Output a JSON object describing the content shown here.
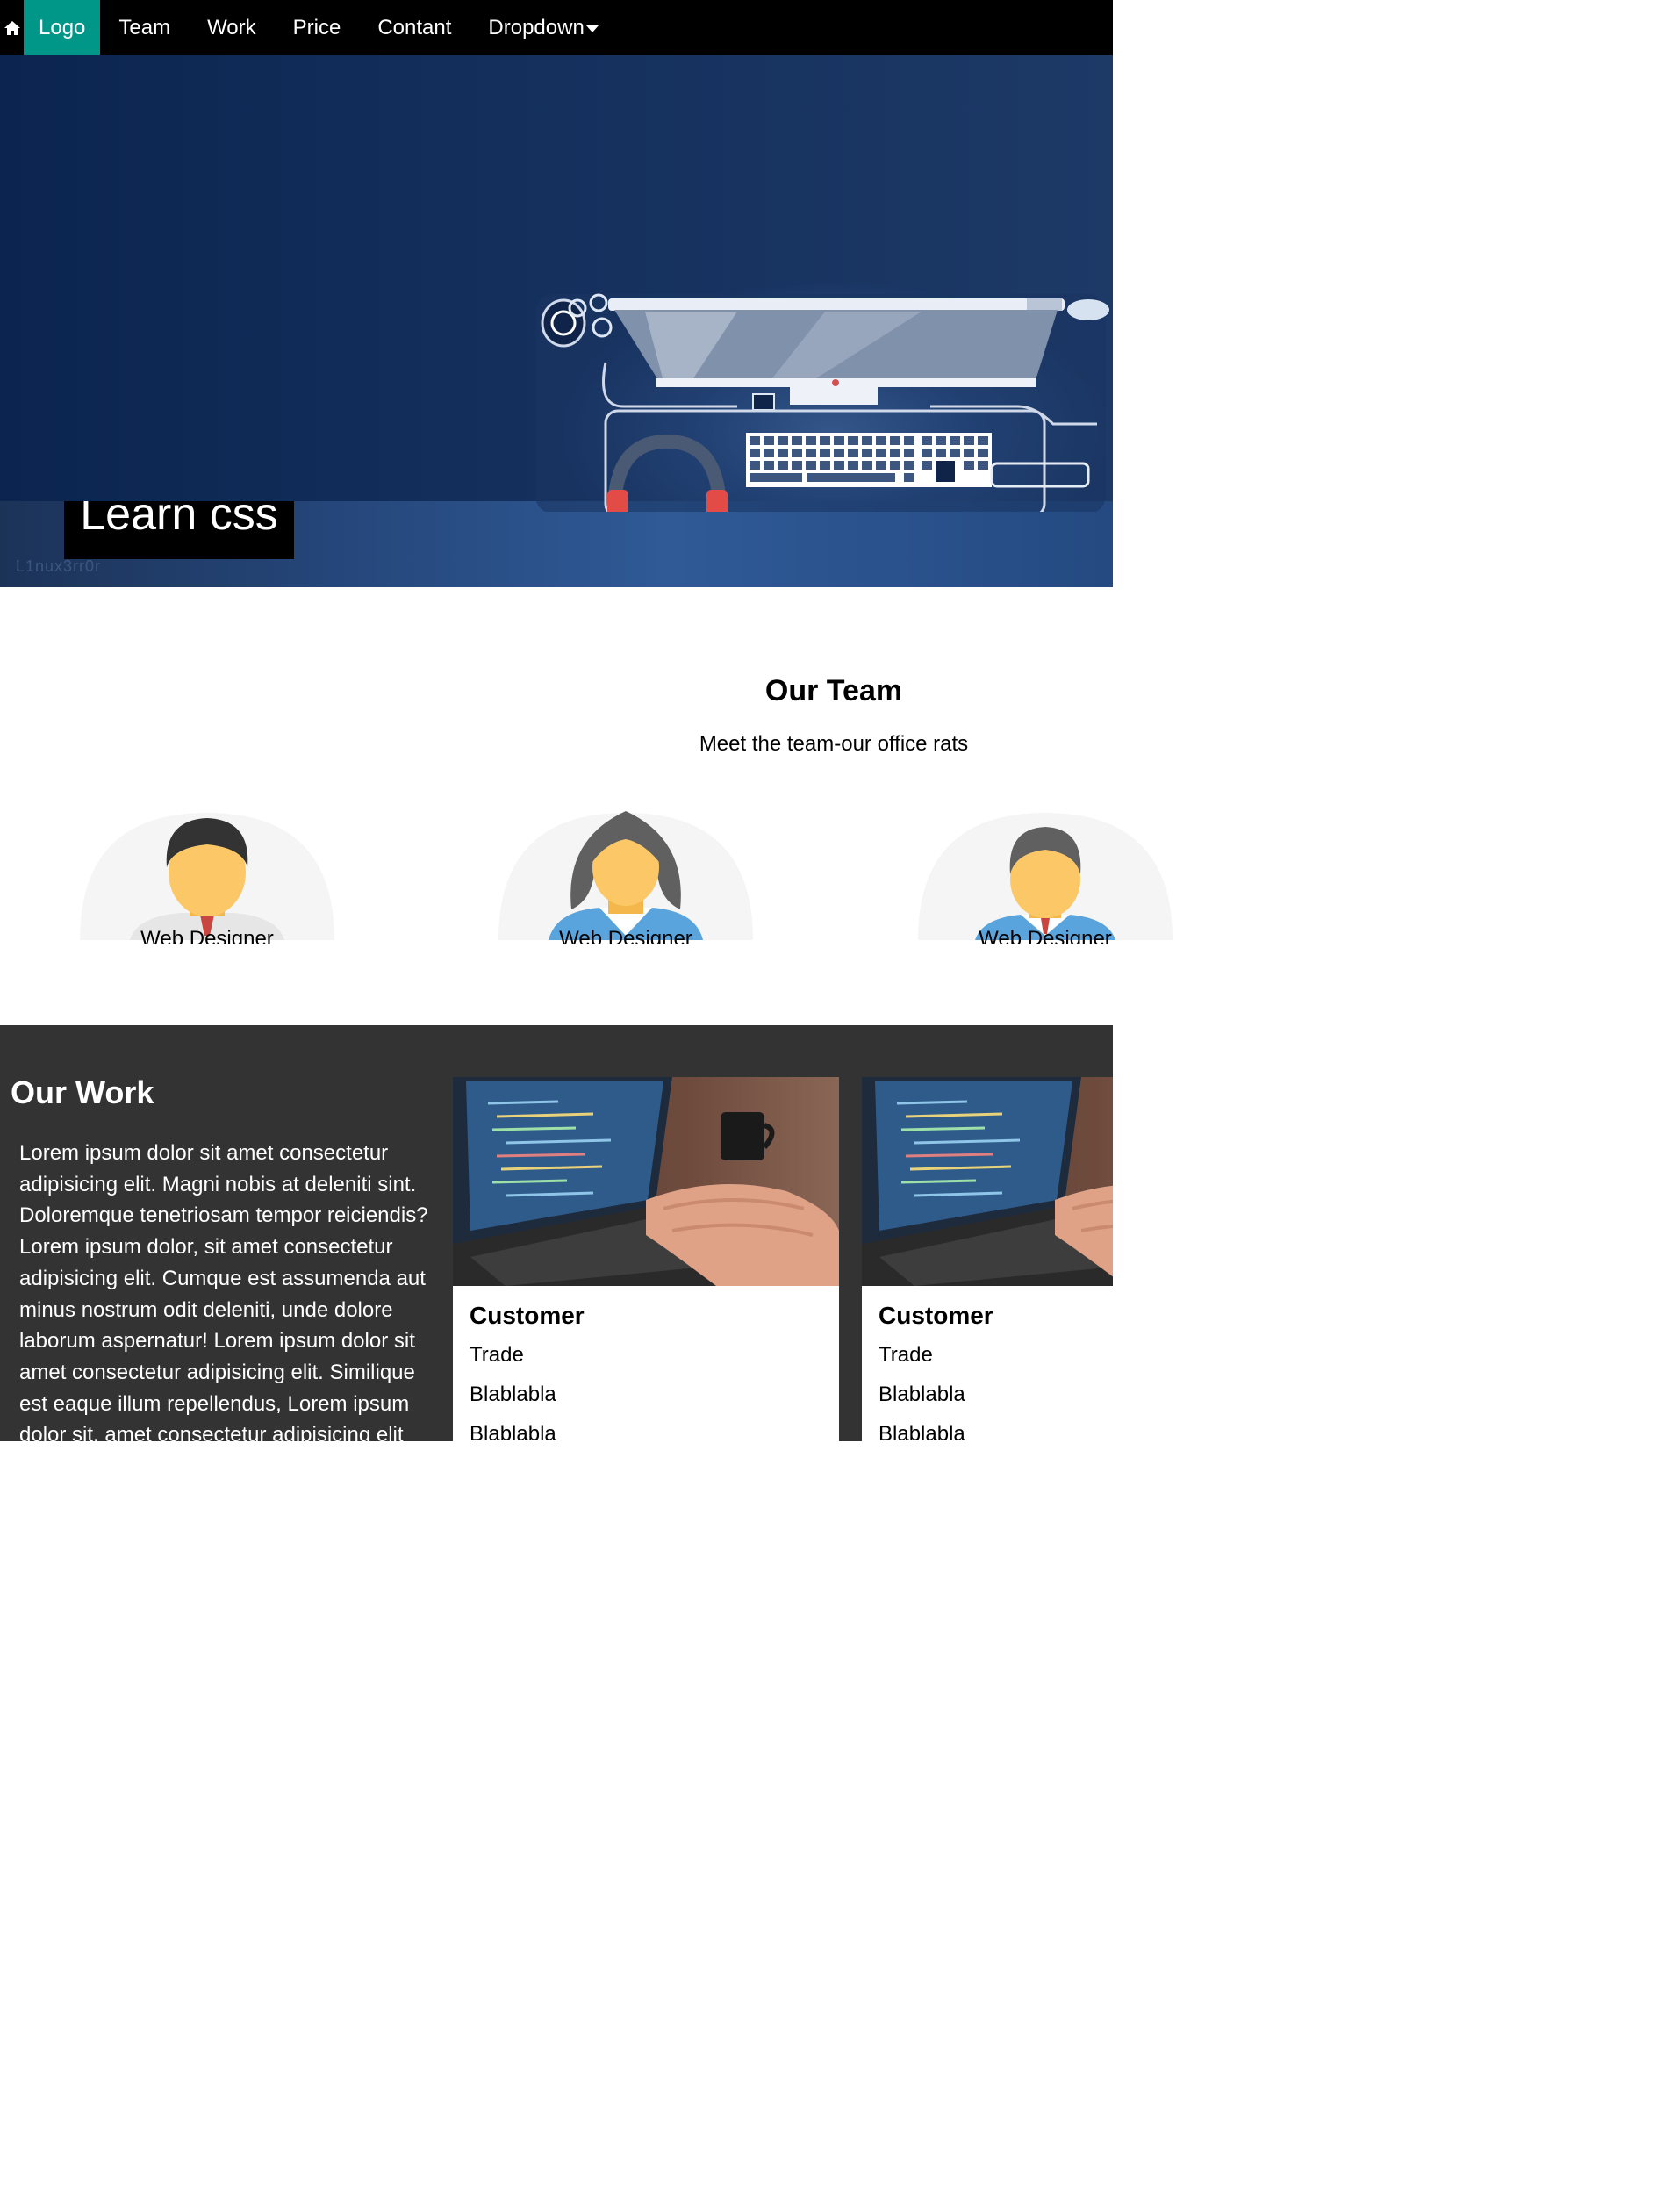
{
  "navbar": {
    "home_icon": "home-icon",
    "logo": "Logo",
    "items": [
      "Team",
      "Work",
      "Price",
      "Contant"
    ],
    "dropdown": "Dropdown"
  },
  "hero": {
    "title": "Learn css",
    "watermark": "L1nux3rr0r"
  },
  "team": {
    "title": "Our Team",
    "subtitle": "Meet the team-our office rats",
    "members": [
      {
        "role": "Web Designer",
        "avatar": "man-avatar"
      },
      {
        "role": "Web Designer",
        "avatar": "woman-avatar"
      },
      {
        "role": "Web Designer",
        "avatar": "man-avatar"
      }
    ]
  },
  "work": {
    "title": "Our Work",
    "text": "Lorem ipsum dolor sit amet consectetur adipisicing elit. Magni nobis at deleniti sint. Doloremque tenetriosam tempor reiciendis? Lorem ipsum dolor, sit amet consectetur adipisicing elit. Cumque est assumenda aut minus nostrum odit deleniti, unde dolore laborum aspernatur! Lorem ipsum dolor sit amet consectetur adipisicing elit. Similique est eaque illum repellendus, Lorem ipsum dolor sit, amet consectetur adipisicing elit",
    "cards": [
      {
        "title": "Customer",
        "lines": [
          "Trade",
          "Blablabla",
          "Blablabla"
        ]
      },
      {
        "title": "Customer",
        "lines": [
          "Trade",
          "Blablabla",
          "Blablabla"
        ]
      }
    ]
  },
  "colors": {
    "navbar_bg": "#000000",
    "logo_bg": "#009688",
    "work_bg": "#333333"
  }
}
